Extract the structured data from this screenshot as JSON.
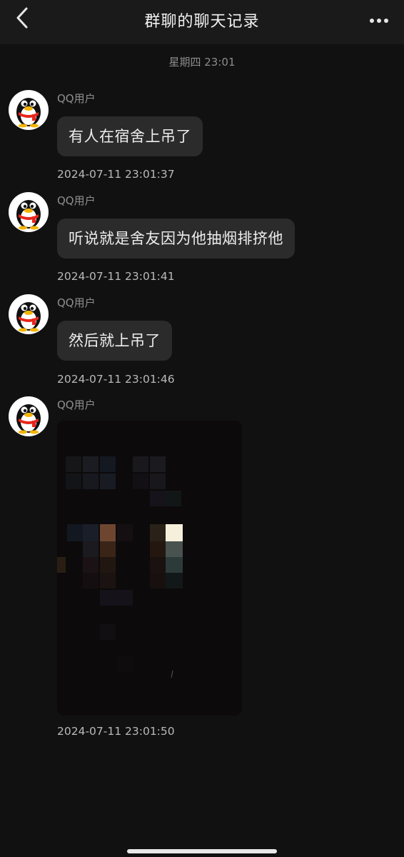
{
  "header": {
    "title": "群聊的聊天记录",
    "back_icon": "chevron-left-icon",
    "more_icon": "more-horizontal-icon"
  },
  "time_separator": "星期四 23:01",
  "messages": [
    {
      "sender": "QQ用户",
      "text": "有人在宿舍上吊了",
      "timestamp": "2024-07-11 23:01:37"
    },
    {
      "sender": "QQ用户",
      "text": "听说就是舍友因为他抽烟排挤他",
      "timestamp": "2024-07-11 23:01:41"
    },
    {
      "sender": "QQ用户",
      "text": "然后就上吊了",
      "timestamp": "2024-07-11 23:01:46"
    },
    {
      "sender": "QQ用户",
      "image": "pixelated-photo",
      "timestamp": "2024-07-11 23:01:50"
    }
  ],
  "colors": {
    "background": "#111111",
    "header": "#1a1a1a",
    "bubble": "#2b2b2b",
    "penguin_scarf": "#e8261b",
    "penguin_beak": "#f5b400"
  }
}
